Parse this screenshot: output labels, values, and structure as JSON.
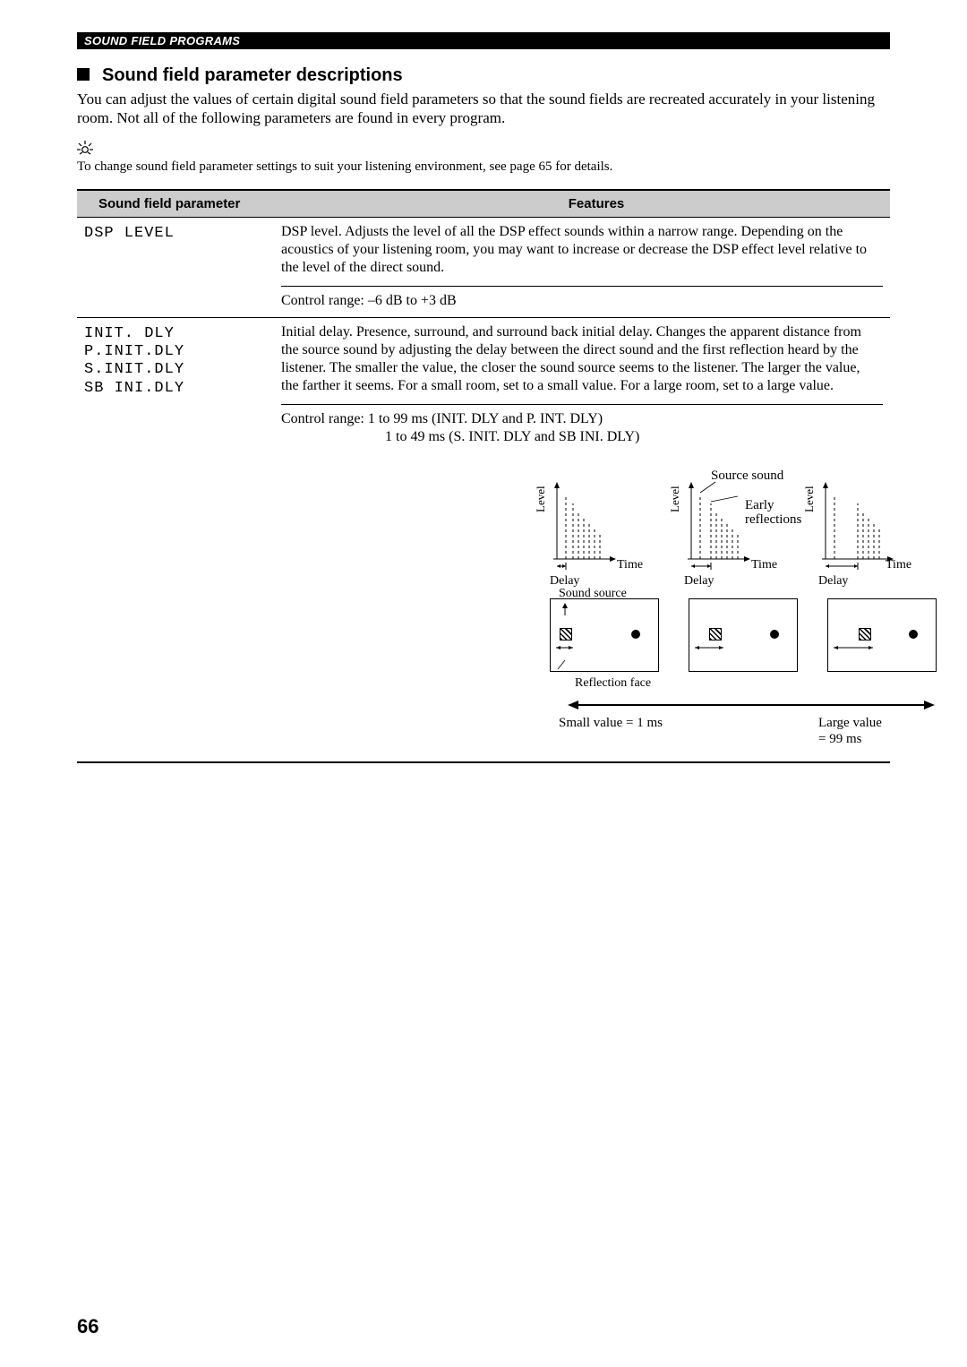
{
  "header_bar": "SOUND FIELD PROGRAMS",
  "section_title": "Sound field parameter descriptions",
  "intro": "You can adjust the values of certain digital sound field parameters so that the sound fields are recreated accurately in your listening room. Not all of the following parameters are found in every program.",
  "hint_text": "To change sound field parameter settings to suit your listening environment, see page 65 for details.",
  "table": {
    "head_param": "Sound field parameter",
    "head_features": "Features",
    "rows": [
      {
        "param_lines": [
          "DSP LEVEL"
        ],
        "desc": "DSP level. Adjusts the level of all the DSP effect sounds within a narrow range. Depending on the acoustics of your listening room, you may want to increase or decrease the DSP effect level relative to the level of the direct sound.",
        "range1": "Control range: –6 dB to +3 dB",
        "range2": ""
      },
      {
        "param_lines": [
          "INIT. DLY",
          "P.INIT.DLY",
          "S.INIT.DLY",
          "SB INI.DLY"
        ],
        "desc": "Initial delay. Presence, surround, and surround back initial delay. Changes the apparent distance from the source sound by adjusting the delay between the direct sound and the first reflection heard by the listener. The smaller the value, the closer the sound source seems to the listener. The larger the value, the farther it seems. For a small room, set to a small value. For a large room, set to a large value.",
        "range1": "Control range: 1 to 99 ms (INIT. DLY and P. INT. DLY)",
        "range2": "1 to 49 ms (S. INIT. DLY and SB INI. DLY)"
      }
    ]
  },
  "diagram": {
    "source_sound": "Source sound",
    "early": "Early\nreflections",
    "level": "Level",
    "time": "Time",
    "delay": "Delay",
    "sound_source": "Sound source",
    "reflection_face": "Reflection face",
    "small_value": "Small value = 1 ms",
    "large_value": "Large value = 99 ms"
  },
  "page_number": "66",
  "chart_data": {
    "type": "bar",
    "description": "Three schematic level-vs-time impulse plots showing source sound followed by early reflections; delay between source sound and first reflection increases from left to right panel.",
    "panels": [
      {
        "delay_relative": "small",
        "reflection_face_distance": "near"
      },
      {
        "delay_relative": "medium",
        "reflection_face_distance": "mid"
      },
      {
        "delay_relative": "large",
        "reflection_face_distance": "far"
      }
    ],
    "value_range": {
      "small_value_ms": 1,
      "large_value_ms": 99
    },
    "xlabel": "Time",
    "ylabel": "Level"
  }
}
